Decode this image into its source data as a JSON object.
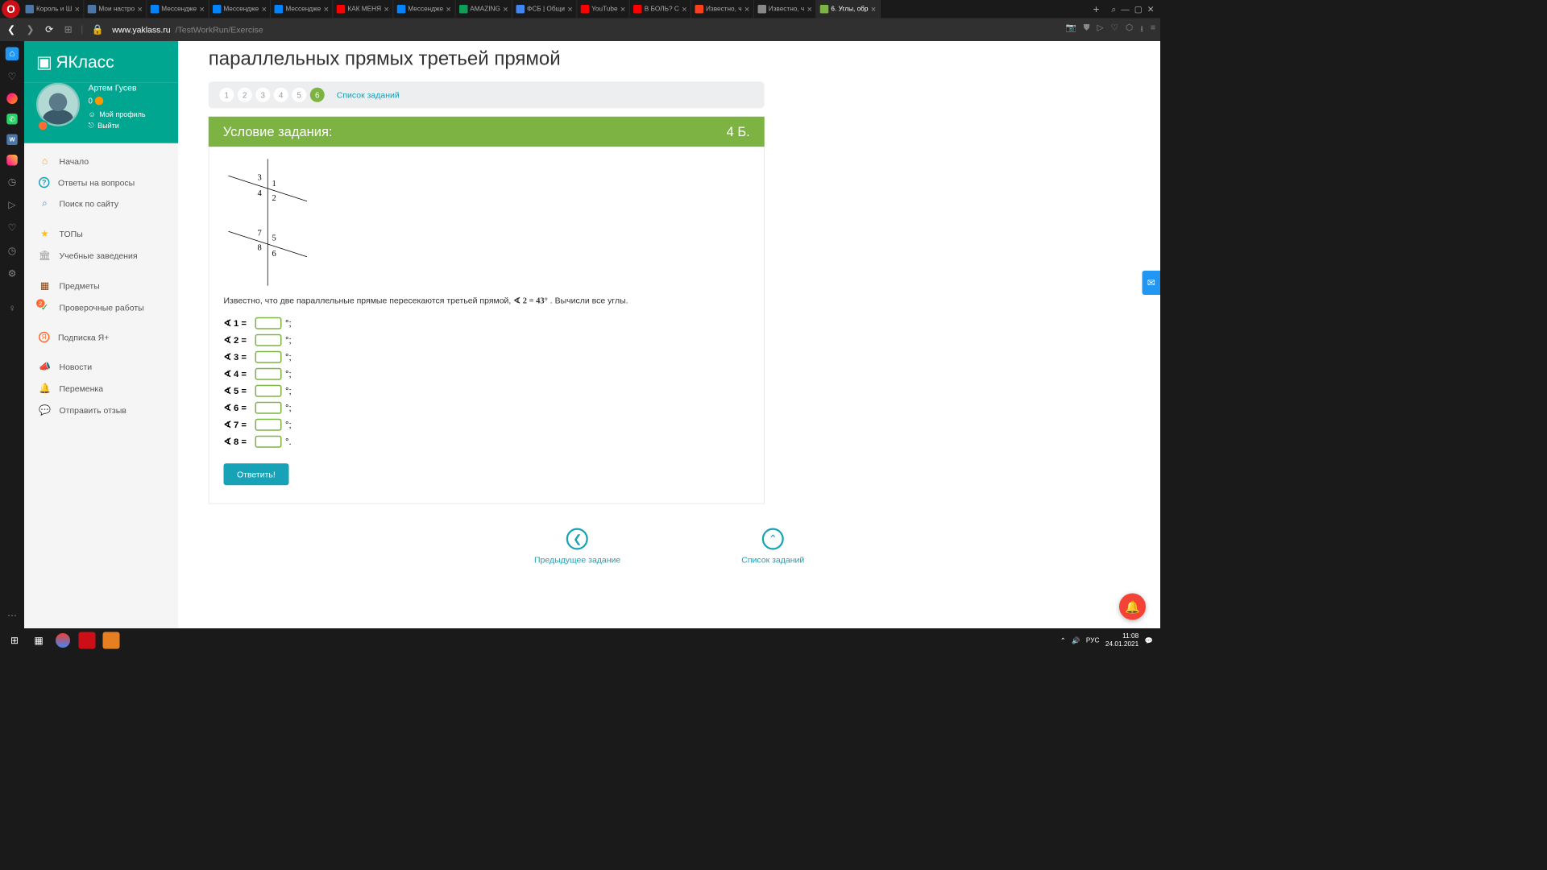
{
  "tabs": [
    {
      "icon": "vk",
      "title": "Король и Ш"
    },
    {
      "icon": "vk",
      "title": "Мои настро"
    },
    {
      "icon": "msg",
      "title": "Мессендже"
    },
    {
      "icon": "msg",
      "title": "Мессендже"
    },
    {
      "icon": "msg",
      "title": "Мессендже"
    },
    {
      "icon": "yt",
      "title": "КАК МЕНЯ"
    },
    {
      "icon": "msg",
      "title": "Мессендже"
    },
    {
      "icon": "gs",
      "title": "AMAZING"
    },
    {
      "icon": "gd",
      "title": "ФСБ | Общи"
    },
    {
      "icon": "yt",
      "title": "YouTube"
    },
    {
      "icon": "yt",
      "title": "В БОЛЬ? С"
    },
    {
      "icon": "ya",
      "title": "Известно, ч"
    },
    {
      "icon": "z",
      "title": "Известно, ч"
    },
    {
      "icon": "yk",
      "title": "6. Углы, обр"
    }
  ],
  "url": {
    "host": "www.yaklass.ru",
    "path": "/TestWorkRun/Exercise"
  },
  "brand": "ЯКласс",
  "profile": {
    "name": "Артем Гусев",
    "score": "0",
    "my_profile": "Мой профиль",
    "logout": "Выйти"
  },
  "menu": {
    "home": "Начало",
    "faq": "Ответы на вопросы",
    "search": "Поиск по сайту",
    "tops": "ТОПы",
    "schools": "Учебные заведения",
    "subjects": "Предметы",
    "tests": "Проверочные работы",
    "tests_badge": "2",
    "subscribe": "Подписка Я+",
    "news": "Новости",
    "break": "Переменка",
    "feedback": "Отправить отзыв"
  },
  "page_title": "параллельных прямых третьей прямой",
  "nav_nums": [
    "1",
    "2",
    "3",
    "4",
    "5",
    "6"
  ],
  "nav_current": 6,
  "task_list": "Список заданий",
  "task_header": "Условие задания:",
  "task_points": "4 Б.",
  "diagram": {
    "n1": "1",
    "n2": "2",
    "n3": "3",
    "n4": "4",
    "n5": "5",
    "n6": "6",
    "n7": "7",
    "n8": "8"
  },
  "task_text_pre": "Известно, что две параллельные прямые пересекаются третьей прямой, ",
  "task_given": "∢ 2 = 43°",
  "task_text_post": ". Вычисли все углы.",
  "angles": [
    {
      "label": "∢ 1 =",
      "suffix": "°;"
    },
    {
      "label": "∢ 2 =",
      "suffix": "°;"
    },
    {
      "label": "∢ 3 =",
      "suffix": "°;"
    },
    {
      "label": "∢ 4 =",
      "suffix": "°;"
    },
    {
      "label": "∢ 5 =",
      "suffix": "°;"
    },
    {
      "label": "∢ 6 =",
      "suffix": "°;"
    },
    {
      "label": "∢ 7 =",
      "suffix": "°;"
    },
    {
      "label": "∢ 8 =",
      "suffix": "°."
    }
  ],
  "submit": "Ответить!",
  "prev_task": "Предыдущее задание",
  "task_list_bottom": "Список заданий",
  "taskbar": {
    "lang": "РУС",
    "time": "11:08",
    "date": "24.01.2021"
  }
}
